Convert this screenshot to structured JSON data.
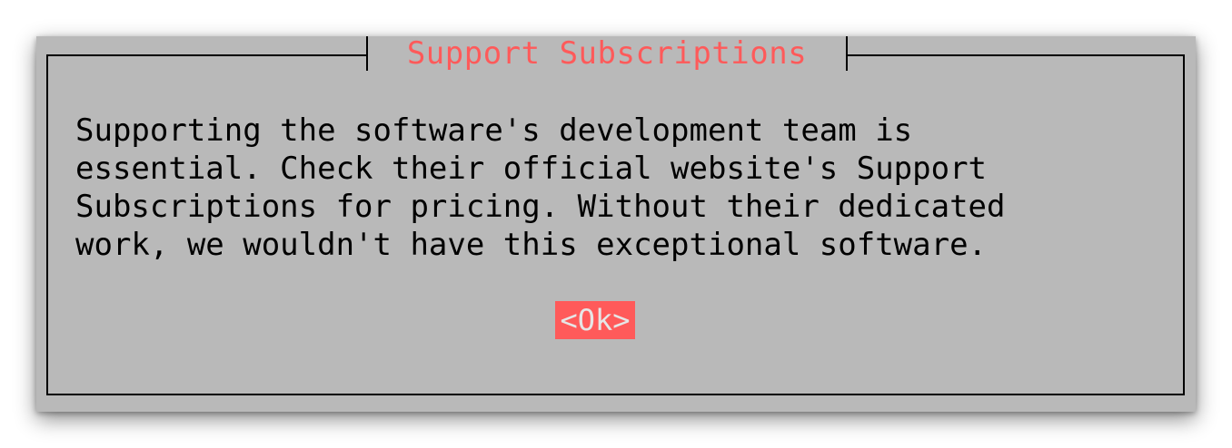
{
  "dialog": {
    "title": "Support Subscriptions",
    "message_lines": [
      "Supporting the software's development team is",
      "essential. Check their official website's Support",
      "Subscriptions for pricing. Without their dedicated",
      "work, we wouldn't have this exceptional software."
    ],
    "ok_label": "<Ok>"
  },
  "colors": {
    "dialog_background": "#b9b9b9",
    "accent": "#ff5a5a",
    "text": "#000000",
    "border": "#000000",
    "button_text": "#e6e6e6"
  }
}
